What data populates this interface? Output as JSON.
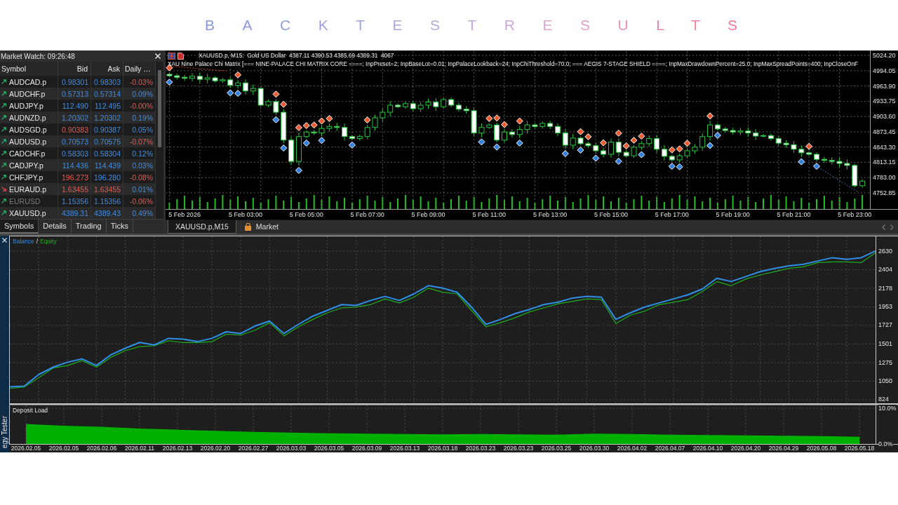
{
  "title": "BACKTEST RESULTS",
  "market_watch": {
    "title": "Market Watch: 09:26:48",
    "columns": [
      "Symbol",
      "Bid",
      "Ask",
      "Daily …"
    ],
    "rows": [
      {
        "symbol": "AUDCAD.p",
        "bid": "0.98301",
        "ask": "0.98303",
        "daily": "-0.03%",
        "rising": true,
        "bid_rising": true,
        "ask_rising": true,
        "daily_rising": false,
        "disabled": false
      },
      {
        "symbol": "AUDCHF.p",
        "bid": "0.57313",
        "ask": "0.57314",
        "daily": "0.09%",
        "rising": true,
        "bid_rising": true,
        "ask_rising": true,
        "daily_rising": true,
        "disabled": false
      },
      {
        "symbol": "AUDJPY.p",
        "bid": "112.490",
        "ask": "112.495",
        "daily": "-0.00%",
        "rising": true,
        "bid_rising": true,
        "ask_rising": true,
        "daily_rising": false,
        "disabled": false
      },
      {
        "symbol": "AUDNZD.p",
        "bid": "1.20302",
        "ask": "1.20302",
        "daily": "0.19%",
        "rising": true,
        "bid_rising": true,
        "ask_rising": true,
        "daily_rising": true,
        "disabled": false
      },
      {
        "symbol": "AUDSGD.p",
        "bid": "0.90383",
        "ask": "0.90387",
        "daily": "0.05%",
        "rising": true,
        "bid_rising": false,
        "ask_rising": true,
        "daily_rising": true,
        "disabled": false
      },
      {
        "symbol": "AUDUSD.p",
        "bid": "0.70573",
        "ask": "0.70575",
        "daily": "-0.07%",
        "rising": true,
        "bid_rising": true,
        "ask_rising": true,
        "daily_rising": false,
        "disabled": false
      },
      {
        "symbol": "CADCHF.p",
        "bid": "0.58303",
        "ask": "0.58304",
        "daily": "0.12%",
        "rising": true,
        "bid_rising": true,
        "ask_rising": true,
        "daily_rising": true,
        "disabled": false
      },
      {
        "symbol": "CADJPY.p",
        "bid": "114.436",
        "ask": "114.439",
        "daily": "0.03%",
        "rising": true,
        "bid_rising": true,
        "ask_rising": true,
        "daily_rising": true,
        "disabled": false
      },
      {
        "symbol": "CHFJPY.p",
        "bid": "196.273",
        "ask": "196.280",
        "daily": "-0.08%",
        "rising": true,
        "bid_rising": false,
        "ask_rising": true,
        "daily_rising": false,
        "disabled": false
      },
      {
        "symbol": "EURAUD.p",
        "bid": "1.63455",
        "ask": "1.63455",
        "daily": "0.01%",
        "rising": false,
        "bid_rising": false,
        "ask_rising": false,
        "daily_rising": true,
        "disabled": false
      },
      {
        "symbol": "EURUSD",
        "bid": "1.15356",
        "ask": "1.15356",
        "daily": "-0.06%",
        "rising": true,
        "bid_rising": true,
        "ask_rising": true,
        "daily_rising": false,
        "disabled": true
      },
      {
        "symbol": "XAUUSD.p",
        "bid": "4389.31",
        "ask": "4389.43",
        "daily": "0.49%",
        "rising": true,
        "bid_rising": true,
        "ask_rising": true,
        "daily_rising": true,
        "disabled": false
      }
    ],
    "tabs": [
      {
        "label": "Symbols",
        "selected": true
      },
      {
        "label": "Details",
        "selected": false
      },
      {
        "label": "Trading",
        "selected": false
      },
      {
        "label": "Ticks",
        "selected": false
      }
    ]
  },
  "chart": {
    "symbol_info": "XAUUSD.p, M15:  Gold US Dollar  4387.11 4390.53 4385.69 4389.31  4067",
    "indicator_info": "XAU Nine Palace Chi Matrix [=== NINE-PALACE CHI MATRIX CORE ====; InpPreset=2; InpBaseLot=0.01; InpPalaceLookback=24; InpChiThreshold=70.0; === AEGIS 7-STAGE SHIELD ====; InpMaxDrawdownPercent=25.0; InpMaxSpreadPoints=400; InpCloseOnF",
    "chart_data": {
      "type": "candlestick",
      "grid": true,
      "categories": [
        null,
        null,
        "5 Feb 2026",
        null,
        null,
        null,
        null,
        null,
        null,
        null,
        "5 Feb 03:00",
        null,
        null,
        null,
        null,
        null,
        null,
        null,
        "5 Feb 05:00",
        null,
        null,
        null,
        null,
        null,
        null,
        null,
        "5 Feb 07:00",
        null,
        null,
        null,
        null,
        null,
        null,
        null,
        "5 Feb 09:00",
        null,
        null,
        null,
        null,
        null,
        null,
        null,
        "5 Feb 11:00",
        null,
        null,
        null,
        null,
        null,
        null,
        null,
        "5 Feb 13:00",
        null,
        null,
        null,
        null,
        null,
        null,
        null,
        "5 Feb 15:00",
        null,
        null,
        null,
        null,
        null,
        null,
        null,
        "5 Feb 17:00",
        null,
        null,
        null,
        null,
        null,
        null,
        null,
        "5 Feb 19:00",
        null,
        null,
        null,
        null,
        null,
        null,
        null,
        "5 Feb 21:00",
        null,
        null,
        null,
        null,
        null,
        null,
        null,
        "5 Feb 23:00",
        null
      ],
      "ohlc": [
        [
          4987,
          4990,
          4981,
          4984
        ],
        [
          4984,
          4988,
          4977,
          4981
        ],
        [
          4981,
          4986,
          4974,
          4979
        ],
        [
          4979,
          4989,
          4973,
          4983
        ],
        [
          4983,
          4990,
          4970,
          4977
        ],
        [
          4977,
          4988,
          4969,
          4980
        ],
        [
          4980,
          4983,
          4971,
          4974
        ],
        [
          4974,
          4980,
          4970,
          4976
        ],
        [
          4976,
          4981,
          4960,
          4965
        ],
        [
          4965,
          4976,
          4959,
          4970
        ],
        [
          4970,
          4977,
          4947,
          4954
        ],
        [
          4954,
          4967,
          4946,
          4959
        ],
        [
          4959,
          4962,
          4923,
          4926
        ],
        [
          4926,
          4937,
          4922,
          4933
        ],
        [
          4933,
          4938,
          4907,
          4912
        ],
        [
          4912,
          4918,
          4851,
          4857
        ],
        [
          4857,
          4864,
          4808,
          4815
        ],
        [
          4815,
          4872,
          4807,
          4864
        ],
        [
          4864,
          4876,
          4861,
          4873
        ],
        [
          4873,
          4877,
          4867,
          4871
        ],
        [
          4871,
          4885,
          4866,
          4880
        ],
        [
          4880,
          4890,
          4874,
          4884
        ],
        [
          4884,
          4891,
          4875,
          4882
        ],
        [
          4882,
          4890,
          4856,
          4864
        ],
        [
          4864,
          4867,
          4857,
          4860
        ],
        [
          4860,
          4868,
          4856,
          4864
        ],
        [
          4864,
          4887,
          4859,
          4882
        ],
        [
          4882,
          4907,
          4876,
          4901
        ],
        [
          4901,
          4919,
          4894,
          4912
        ],
        [
          4912,
          4934,
          4904,
          4926
        ],
        [
          4926,
          4929,
          4920,
          4923
        ],
        [
          4923,
          4933,
          4919,
          4929
        ],
        [
          4929,
          4934,
          4914,
          4919
        ],
        [
          4919,
          4932,
          4913,
          4926
        ],
        [
          4926,
          4939,
          4919,
          4932
        ],
        [
          4932,
          4940,
          4915,
          4923
        ],
        [
          4923,
          4940,
          4920,
          4937
        ],
        [
          4937,
          4941,
          4922,
          4926
        ],
        [
          4926,
          4931,
          4913,
          4918
        ],
        [
          4918,
          4924,
          4909,
          4915
        ],
        [
          4915,
          4922,
          4864,
          4871
        ],
        [
          4871,
          4890,
          4863,
          4882
        ],
        [
          4882,
          4890,
          4879,
          4887
        ],
        [
          4887,
          4891,
          4853,
          4857
        ],
        [
          4857,
          4878,
          4852,
          4873
        ],
        [
          4873,
          4879,
          4862,
          4868
        ],
        [
          4868,
          4885,
          4861,
          4878
        ],
        [
          4878,
          4895,
          4870,
          4887
        ],
        [
          4887,
          4890,
          4881,
          4884
        ],
        [
          4884,
          4894,
          4880,
          4890
        ],
        [
          4890,
          4895,
          4879,
          4884
        ],
        [
          4884,
          4890,
          4865,
          4871
        ],
        [
          4871,
          4878,
          4840,
          4847
        ],
        [
          4847,
          4869,
          4839,
          4861
        ],
        [
          4861,
          4864,
          4847,
          4850
        ],
        [
          4850,
          4854,
          4842,
          4846
        ],
        [
          4846,
          4851,
          4831,
          4836
        ],
        [
          4836,
          4842,
          4823,
          4829
        ],
        [
          4829,
          4860,
          4822,
          4853
        ],
        [
          4853,
          4861,
          4825,
          4833
        ],
        [
          4833,
          4836,
          4823,
          4826
        ],
        [
          4826,
          4847,
          4822,
          4843
        ],
        [
          4843,
          4855,
          4838,
          4850
        ],
        [
          4850,
          4866,
          4844,
          4860
        ],
        [
          4860,
          4867,
          4832,
          4839
        ],
        [
          4839,
          4847,
          4817,
          4825
        ],
        [
          4825,
          4828,
          4815,
          4818
        ],
        [
          4818,
          4830,
          4814,
          4826
        ],
        [
          4826,
          4841,
          4821,
          4836
        ],
        [
          4836,
          4849,
          4830,
          4843
        ],
        [
          4843,
          4871,
          4836,
          4864
        ],
        [
          4864,
          4895,
          4856,
          4887
        ],
        [
          4887,
          4890,
          4876,
          4879
        ],
        [
          4879,
          4883,
          4872,
          4876
        ],
        [
          4876,
          4881,
          4868,
          4873
        ],
        [
          4873,
          4881,
          4867,
          4875
        ],
        [
          4875,
          4882,
          4864,
          4871
        ],
        [
          4871,
          4879,
          4857,
          4865
        ],
        [
          4865,
          4869,
          4862,
          4866
        ],
        [
          4866,
          4870,
          4856,
          4860
        ],
        [
          4860,
          4865,
          4846,
          4851
        ],
        [
          4851,
          4857,
          4842,
          4848
        ],
        [
          4848,
          4855,
          4832,
          4839
        ],
        [
          4839,
          4847,
          4824,
          4832
        ],
        [
          4832,
          4835,
          4826,
          4829
        ],
        [
          4829,
          4833,
          4815,
          4819
        ],
        [
          4819,
          4824,
          4812,
          4817
        ],
        [
          4817,
          4823,
          4809,
          4815
        ],
        [
          4815,
          4822,
          4804,
          4811
        ],
        [
          4811,
          4819,
          4799,
          4807
        ],
        [
          4807,
          4810,
          4764,
          4767
        ],
        [
          4767,
          4780,
          4763,
          4776
        ]
      ],
      "ylim": [
        4721.0,
        5033.9
      ],
      "yticks": [
        {
          "value": 5024.2,
          "label": "5024.20"
        },
        {
          "value": 4994.05,
          "label": "4994.05"
        },
        {
          "value": 4963.9,
          "label": "4963.90"
        },
        {
          "value": 4933.75,
          "label": "4933.75"
        },
        {
          "value": 4903.6,
          "label": "4903.60"
        },
        {
          "value": 4873.45,
          "label": "4873.45"
        },
        {
          "value": 4843.3,
          "label": "4843.30"
        },
        {
          "value": 4813.15,
          "label": "4813.15"
        },
        {
          "value": 4783.0,
          "label": "4783.00"
        },
        {
          "value": 4752.85,
          "label": "4752.85"
        }
      ]
    },
    "tabs": [
      {
        "label": "XAUUSD.p,M15",
        "selected": true,
        "kind": "chart"
      },
      {
        "label": "Market",
        "selected": false,
        "kind": "market"
      }
    ]
  },
  "tester": {
    "title": "egy Tester",
    "balance_chart": {
      "separator": "/",
      "chart_data": {
        "type": "line",
        "grid": true,
        "series": [
          {
            "name": "Balance",
            "color": "#2f8fe6",
            "values": [
              980,
              990,
              1130,
              1220,
              1280,
              1320,
              1240,
              1370,
              1450,
              1520,
              1490,
              1570,
              1560,
              1530,
              1570,
              1650,
              1630,
              1720,
              1780,
              1630,
              1740,
              1840,
              1910,
              1980,
              1970,
              2030,
              2080,
              2030,
              2110,
              2210,
              2180,
              2130,
              1950,
              1740,
              1800,
              1870,
              1920,
              1980,
              2010,
              2060,
              2080,
              2070,
              1800,
              1880,
              1950,
              2000,
              2050,
              2100,
              2170,
              2300,
              2260,
              2320,
              2380,
              2420,
              2450,
              2470,
              2510,
              2550,
              2530,
              2550,
              2630
            ]
          },
          {
            "name": "Equity",
            "color": "#1fae1f",
            "values": [
              960,
              980,
              1090,
              1210,
              1240,
              1300,
              1220,
              1340,
              1420,
              1470,
              1480,
              1540,
              1520,
              1520,
              1530,
              1620,
              1610,
              1670,
              1760,
              1600,
              1710,
              1800,
              1880,
              1940,
              1950,
              1980,
              2050,
              2000,
              2070,
              2180,
              2130,
              2110,
              1910,
              1710,
              1760,
              1820,
              1890,
              1940,
              1990,
              2020,
              2050,
              2040,
              1750,
              1850,
              1900,
              1980,
              2010,
              2040,
              2140,
              2260,
              2210,
              2290,
              2340,
              2380,
              2420,
              2440,
              2490,
              2500,
              2500,
              2490,
              2610
            ]
          }
        ],
        "ylim": [
          781,
          2809
        ],
        "yticks": [
          824,
          1050,
          1275,
          1501,
          1727,
          1953,
          2178,
          2404,
          2630
        ]
      }
    },
    "deposit_chart": {
      "chart_data": {
        "type": "area",
        "grid": true,
        "title": "Deposit Load",
        "categories": [
          "2026.02.05",
          "2026.02.05",
          "2026.02.06",
          "2026.02.11",
          "2026.02.13",
          "2026.02.20",
          "2026.02.27",
          "2026.03.03",
          "2026.03.05",
          "2026.03.09",
          "2026.03.13",
          "2026.03.18",
          "2026.03.23",
          "2026.03.23",
          "2026.03.25",
          "2026.03.30",
          "2026.04.02",
          "2026.04.07",
          "2026.04.10",
          "2026.04.20",
          "2026.04.29",
          "2026.05.08",
          "2026.05.18"
        ],
        "values": [
          5.6,
          5.1,
          4.8,
          4.3,
          4.0,
          3.7,
          3.4,
          3.2,
          3.0,
          2.9,
          2.8,
          2.7,
          2.8,
          2.7,
          2.6,
          2.9,
          2.8,
          2.6,
          2.5,
          2.4,
          2.3,
          2.2,
          2.0
        ],
        "ylim": [
          0,
          10.8
        ],
        "yticks": [
          {
            "value": 0,
            "label": "0.0%"
          },
          {
            "value": 10,
            "label": "10.0%"
          }
        ]
      }
    }
  }
}
